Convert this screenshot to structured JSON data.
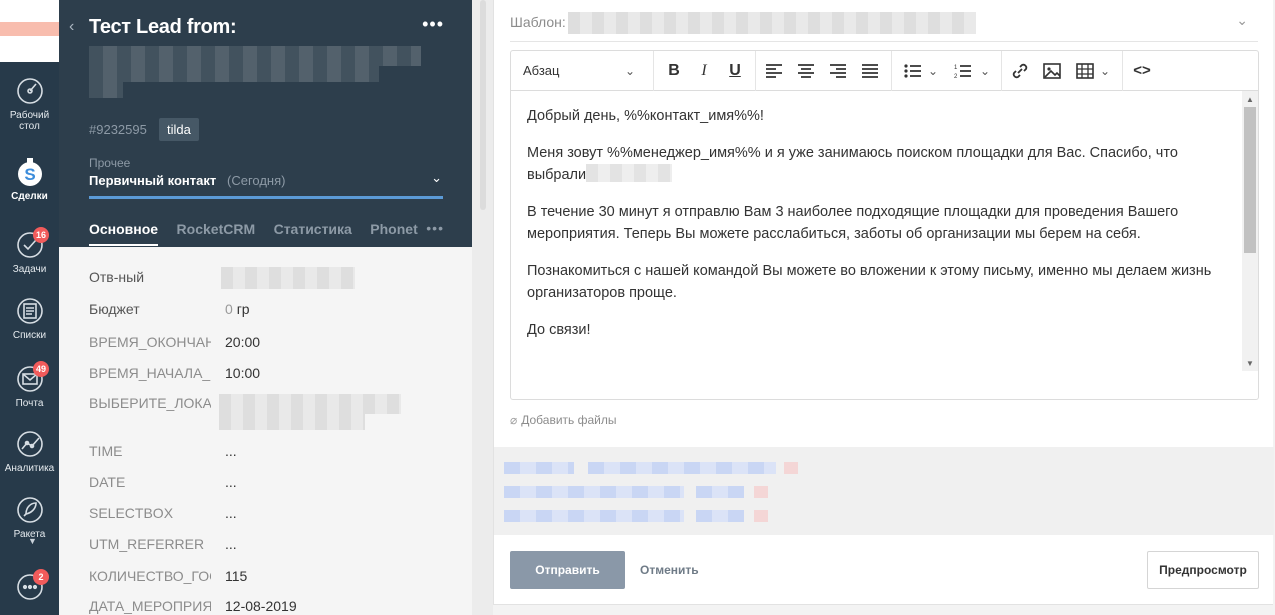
{
  "nav": {
    "items": [
      {
        "label_top": "Рабочий",
        "label_bottom": "стол",
        "icon": "dashboard-icon"
      },
      {
        "label": "Сделки",
        "icon": "deals-icon"
      },
      {
        "label": "Задачи",
        "icon": "tasks-icon",
        "badge": "16"
      },
      {
        "label": "Списки",
        "icon": "lists-icon"
      },
      {
        "label": "Почта",
        "icon": "mail-icon",
        "badge": "49"
      },
      {
        "label": "Аналитика",
        "icon": "analytics-icon"
      },
      {
        "label": "Ракета",
        "icon": "rocket-icon"
      },
      {
        "label": "",
        "icon": "chat-icon",
        "badge": "2"
      }
    ]
  },
  "lead": {
    "title": "Тест Lead from:",
    "id": "#9232595",
    "tag": "tilda",
    "pipeline_group": "Прочее",
    "stage": "Первичный контакт",
    "stage_date": "(Сегодня)",
    "tabs": [
      "Основное",
      "RocketCRM",
      "Статистика",
      "Phonet"
    ],
    "fields": [
      {
        "label": "Отв-ный",
        "value": ""
      },
      {
        "label": "Бюджет",
        "value_muted": "0",
        "value": "гр"
      },
      {
        "label": "ВРЕМЯ_ОКОНЧАНИЯ",
        "value": "20:00"
      },
      {
        "label": "ВРЕМЯ_НАЧАЛА_МЕРОПРИЯТИЯ",
        "value": "10:00"
      },
      {
        "label": "ВЫБЕРИТЕ_ЛОКАЛЬ",
        "value": ""
      },
      {
        "label": "TIME",
        "value": "..."
      },
      {
        "label": "DATE",
        "value": "..."
      },
      {
        "label": "SELECTBOX",
        "value": "..."
      },
      {
        "label": "UTM_REFERRER",
        "value": "..."
      },
      {
        "label": "КОЛИЧЕСТВО_ГОСТЕЙ",
        "value": "115"
      },
      {
        "label": "ДАТА_МЕРОПРИЯТИЯ",
        "value": "12-08-2019"
      }
    ]
  },
  "mail": {
    "template_label": "Шаблон:",
    "toolbar": {
      "paragraph": "Абзац"
    },
    "body": {
      "p1": "Добрый день, %%контакт_имя%%!",
      "p2": "Меня зовут %%менеджер_имя%% и я уже занимаюсь поиском площадки для Вас. Спасибо, что выбрали",
      "p3": "В течение 30 минут я отправлю Вам 3 наиболее подходящие площадки для проведения Вашего мероприятия. Теперь Вы можете расслабиться, заботы об организации мы берем на себя.",
      "p4": "Познакомиться с нашей командой Вы можете во вложении к этому письму, именно мы делаем жизнь организаторов проще.",
      "p5": "До связи!"
    },
    "attach_label": "Добавить файлы",
    "send_label": "Отправить",
    "cancel_label": "Отменить",
    "preview_label": "Предпросмотр"
  }
}
